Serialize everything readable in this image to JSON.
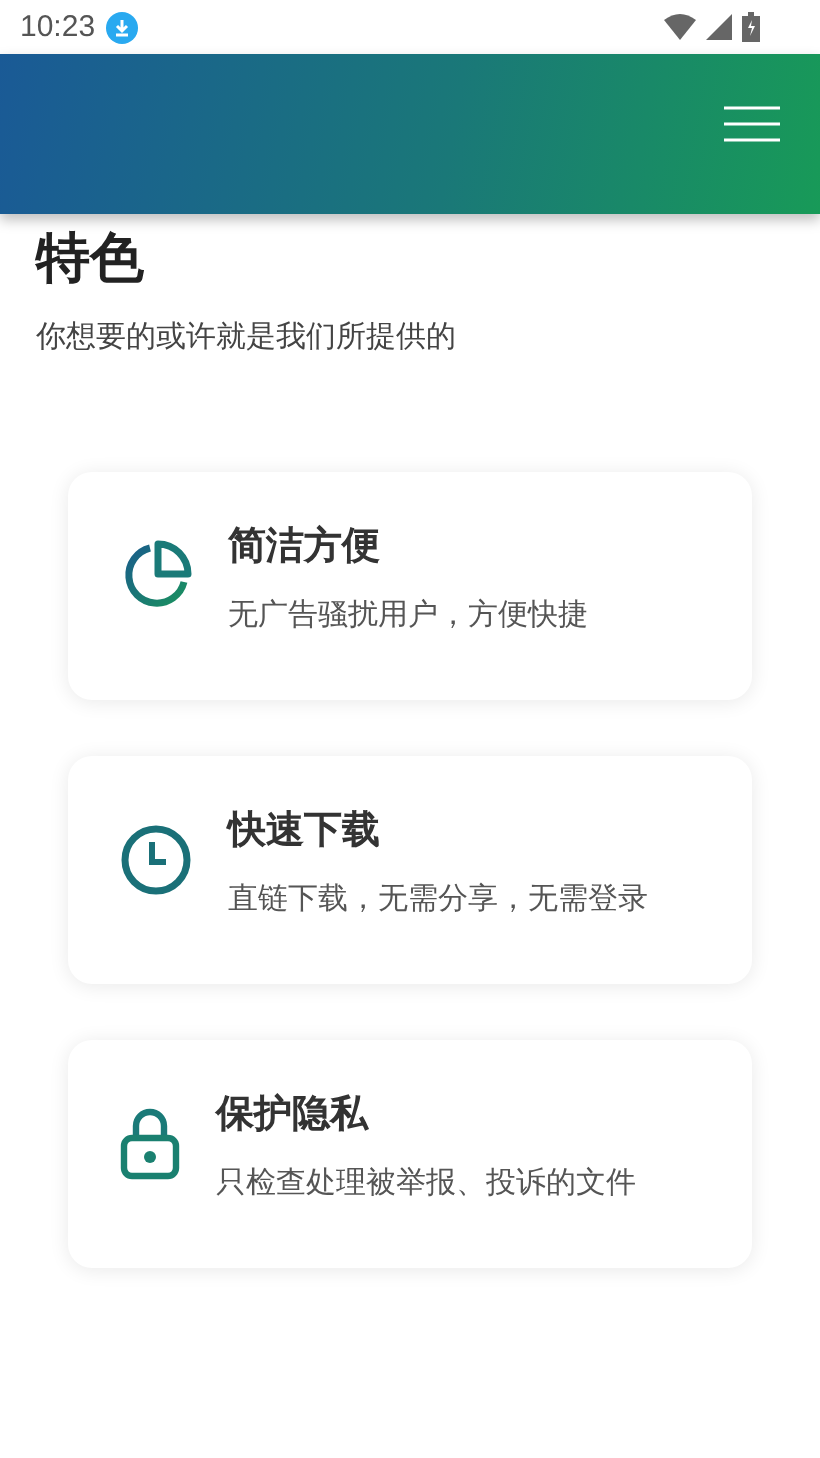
{
  "status_bar": {
    "time": "10:23"
  },
  "section": {
    "title": "特色",
    "subtitle": "你想要的或许就是我们所提供的"
  },
  "features": [
    {
      "kind": "pie",
      "title": "简洁方便",
      "description": "无广告骚扰用户，方便快捷"
    },
    {
      "kind": "clock",
      "title": "快速下载",
      "description": "直链下载，无需分享，无需登录"
    },
    {
      "kind": "lock",
      "title": "保护隐私",
      "description": "只检查处理被举报、投诉的文件"
    }
  ]
}
